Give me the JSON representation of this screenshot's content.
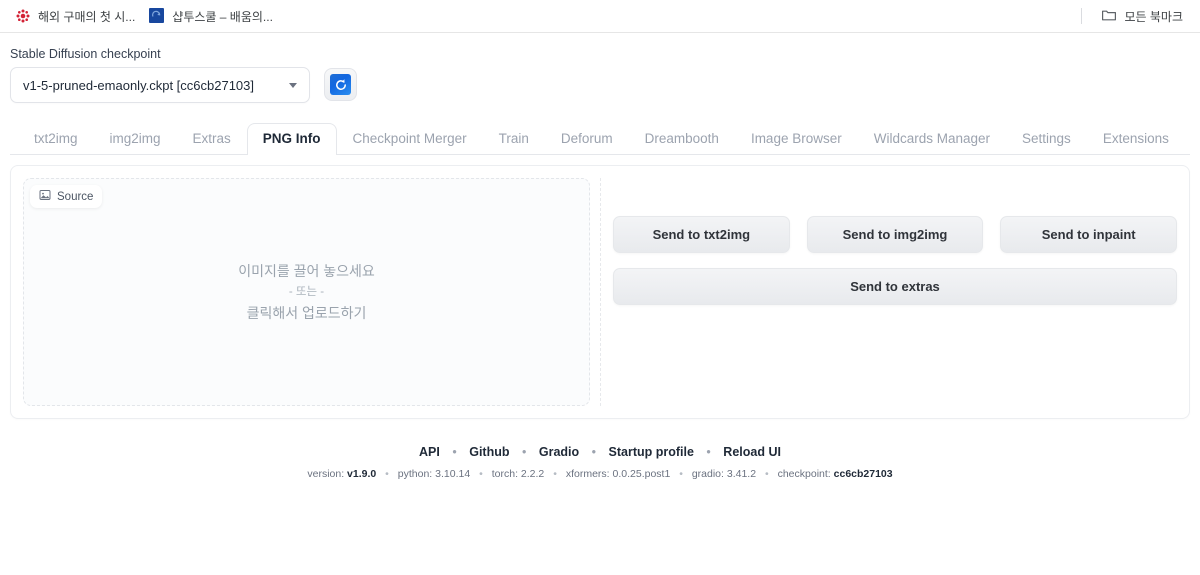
{
  "browser": {
    "bookmarks": [
      {
        "favicon": "red-flower-icon",
        "label": "해외 구매의 첫 시..."
      },
      {
        "favicon": "blue-square-icon",
        "label": "샵투스쿨 – 배움의..."
      }
    ],
    "all_bookmarks": {
      "icon": "folder-icon",
      "label": "모든 북마크"
    }
  },
  "checkpoint": {
    "label": "Stable Diffusion checkpoint",
    "value": "v1-5-pruned-emaonly.ckpt [cc6cb27103]",
    "dropdown_icon": "chevron-down-icon",
    "refresh_icon": "refresh-icon"
  },
  "tabs": [
    {
      "label": "txt2img",
      "active": false
    },
    {
      "label": "img2img",
      "active": false
    },
    {
      "label": "Extras",
      "active": false
    },
    {
      "label": "PNG Info",
      "active": true
    },
    {
      "label": "Checkpoint Merger",
      "active": false
    },
    {
      "label": "Train",
      "active": false
    },
    {
      "label": "Deforum",
      "active": false
    },
    {
      "label": "Dreambooth",
      "active": false
    },
    {
      "label": "Image Browser",
      "active": false
    },
    {
      "label": "Wildcards Manager",
      "active": false
    },
    {
      "label": "Settings",
      "active": false
    },
    {
      "label": "Extensions",
      "active": false
    }
  ],
  "source_panel": {
    "tag_label": "Source",
    "tag_icon": "image-icon",
    "drop_line1": "이미지를 끌어 놓으세요",
    "drop_line2": "- 또는 -",
    "drop_line3": "클릭해서 업로드하기"
  },
  "actions": {
    "send_txt2img": "Send to txt2img",
    "send_img2img": "Send to img2img",
    "send_inpaint": "Send to inpaint",
    "send_extras": "Send to extras"
  },
  "footer": {
    "links": [
      "API",
      "Github",
      "Gradio",
      "Startup profile",
      "Reload UI"
    ],
    "separator": "•",
    "versions": [
      {
        "key": "version:",
        "val": "v1.9.0",
        "bold": true
      },
      {
        "key": "python:",
        "val": "3.10.14",
        "bold": false
      },
      {
        "key": "torch:",
        "val": "2.2.2",
        "bold": false
      },
      {
        "key": "xformers:",
        "val": "0.0.25.post1",
        "bold": false
      },
      {
        "key": "gradio:",
        "val": "3.41.2",
        "bold": false
      },
      {
        "key": "checkpoint:",
        "val": "cc6cb27103",
        "bold": true
      }
    ]
  },
  "colors": {
    "accent_blue": "#1266e0",
    "favicon_red": "#d32236",
    "favicon_blue": "#18479e",
    "text_dark": "#1f2937",
    "text_muted": "#9ca3af"
  }
}
